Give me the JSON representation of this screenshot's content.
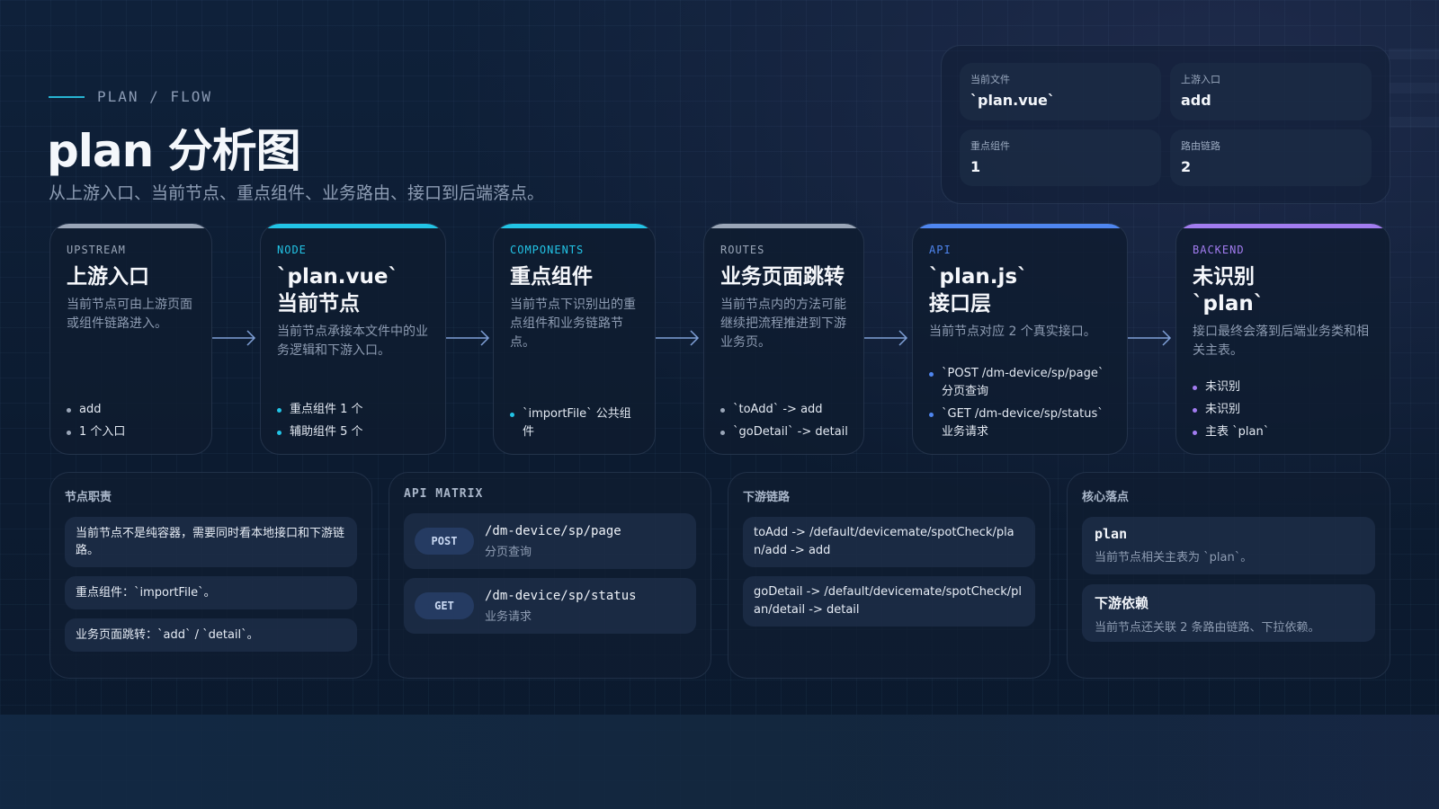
{
  "header": {
    "eyebrow": "PLAN / FLOW",
    "title": "plan 分析图",
    "subtitle": "从上游入口、当前节点、重点组件、业务路由、接口到后端落点。"
  },
  "stats": [
    {
      "label": "当前文件",
      "value": "`plan.vue`"
    },
    {
      "label": "上游入口",
      "value": "add"
    },
    {
      "label": "重点组件",
      "value": "1"
    },
    {
      "label": "路由链路",
      "value": "2"
    }
  ],
  "colors": {
    "upstream": "#9aa6b8",
    "node": "#22c4e6",
    "components": "#22c4e6",
    "routes": "#9aa6b8",
    "api": "#4f86f0",
    "backend": "#a27cf0",
    "arrow": "#7f9fd6"
  },
  "flow": [
    {
      "kicker": "UPSTREAM",
      "title1": "上游入口",
      "title2": "",
      "desc": "当前节点可由上游页面或组件链路进入。",
      "items": [
        "add",
        "1 个入口"
      ]
    },
    {
      "kicker": "NODE",
      "title1": "`plan.vue`",
      "title2": "当前节点",
      "desc": "当前节点承接本文件中的业务逻辑和下游入口。",
      "items": [
        "重点组件 1 个",
        "辅助组件 5 个"
      ]
    },
    {
      "kicker": "COMPONENTS",
      "title1": "重点组件",
      "title2": "",
      "desc": "当前节点下识别出的重点组件和业务链路节点。",
      "items": [
        "`importFile` 公共组件"
      ]
    },
    {
      "kicker": "ROUTES",
      "title1": "业务页面跳转",
      "title2": "",
      "desc": "当前节点内的方法可能继续把流程推进到下游业务页。",
      "items": [
        "`toAdd` -> add",
        "`goDetail` -> detail"
      ]
    },
    {
      "kicker": "API",
      "title1": "`plan.js`",
      "title2": "接口层",
      "desc": "当前节点对应 2 个真实接口。",
      "items": [
        "`POST /dm-device/sp/page` 分页查询",
        "`GET /dm-device/sp/status` 业务请求"
      ]
    },
    {
      "kicker": "BACKEND",
      "title1": "未识别",
      "title2": "`plan`",
      "desc": "接口最终会落到后端业务类和相关主表。",
      "items": [
        "未识别",
        "未识别",
        "主表 `plan`"
      ]
    }
  ],
  "duties": {
    "title": "节点职责",
    "items": [
      "当前节点不是纯容器，需要同时看本地接口和下游链路。",
      "重点组件：`importFile`。",
      "业务页面跳转：`add` / `detail`。"
    ]
  },
  "api_matrix": {
    "title": "API MATRIX",
    "rows": [
      {
        "method": "POST",
        "path": "/dm-device/sp/page",
        "desc": "分页查询"
      },
      {
        "method": "GET",
        "path": "/dm-device/sp/status",
        "desc": "业务请求"
      }
    ]
  },
  "downstream": {
    "title": "下游链路",
    "items": [
      "toAdd -> /default/devicemate/spotCheck/plan/add -> add",
      "goDetail -> /default/devicemate/spotCheck/plan/detail -> detail"
    ]
  },
  "core": {
    "title": "核心落点",
    "items": [
      {
        "title": "plan",
        "desc": "当前节点相关主表为 `plan`。"
      },
      {
        "title": "下游依赖",
        "desc": "当前节点还关联 2 条路由链路、下拉依赖。"
      }
    ]
  }
}
